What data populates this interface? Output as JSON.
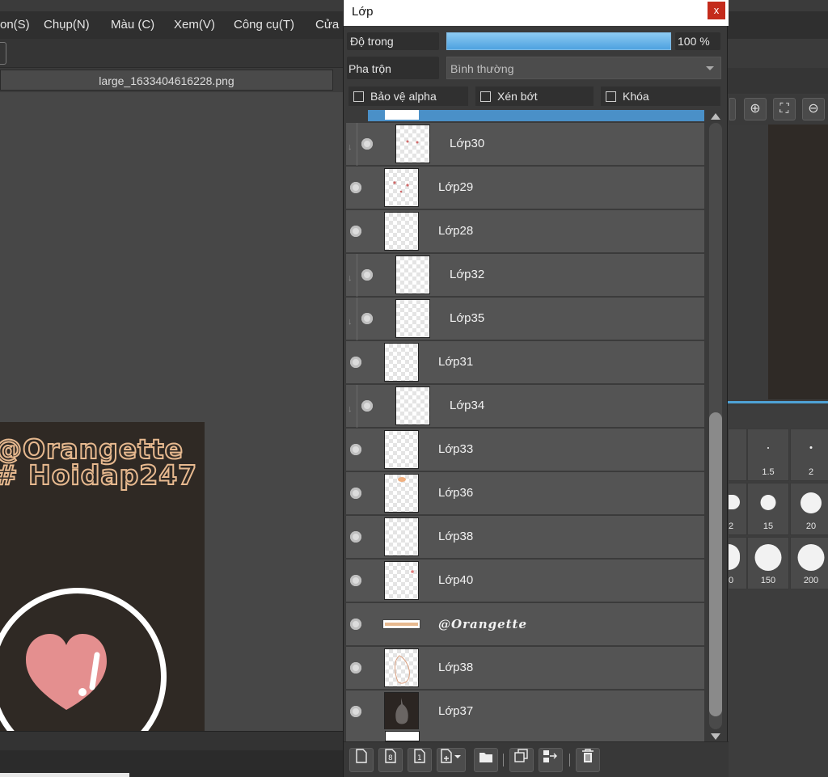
{
  "menu": {
    "items": [
      "on(S)",
      "Chụp(N)",
      "Màu (C)",
      "Xem(V)",
      "Công cụ(T)",
      "Cửa"
    ]
  },
  "document": {
    "tab_title": "large_1633404616228.png",
    "art_line1": "@Orangette",
    "art_line2": "# Hoidap247"
  },
  "layer_dialog": {
    "title": "Lớp",
    "close_label": "x",
    "opacity_label": "Độ trong",
    "opacity_value": "100 %",
    "opacity_level": 1.0,
    "blend_label": "Pha trộn",
    "blend_value": "Bình thường",
    "checkboxes": {
      "protect_alpha": "Bảo vệ alpha",
      "clipping": "Xén bớt",
      "lock": "Khóa"
    },
    "layers": [
      {
        "name": "Lớp30",
        "clipped": true
      },
      {
        "name": "Lớp29",
        "clipped": false
      },
      {
        "name": "Lớp28",
        "clipped": false
      },
      {
        "name": "Lớp32",
        "clipped": true
      },
      {
        "name": "Lớp35",
        "clipped": true
      },
      {
        "name": "Lớp31",
        "clipped": false
      },
      {
        "name": "Lớp34",
        "clipped": true
      },
      {
        "name": "Lớp33",
        "clipped": false
      },
      {
        "name": "Lớp36",
        "clipped": false
      },
      {
        "name": "Lớp38",
        "clipped": false
      },
      {
        "name": "Lớp40",
        "clipped": false
      },
      {
        "name": "@Orangette",
        "clipped": false
      },
      {
        "name": "Lớp38",
        "clipped": false
      },
      {
        "name": "Lớp37",
        "clipped": false
      }
    ]
  },
  "brush_sizes": {
    "row1": [
      "1.5",
      "2"
    ],
    "row2": [
      "2",
      "15",
      "20"
    ],
    "row3": [
      "0",
      "150",
      "200"
    ]
  },
  "colors": {
    "accent": "#4ea2d6",
    "heart": "#e48f8f",
    "text_outline": "#e7b98f",
    "close": "#c42b1c"
  }
}
